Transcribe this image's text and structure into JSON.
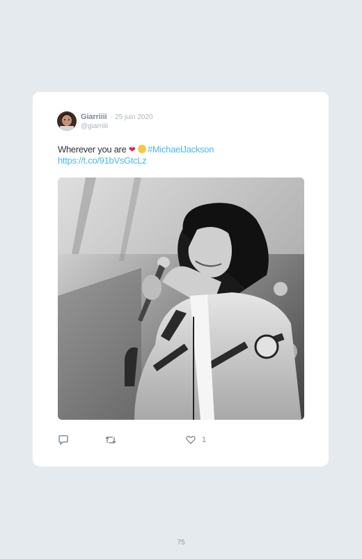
{
  "tweet": {
    "author_name": "Giarriiii",
    "date": "· 25 juin 2020",
    "handle": "@giarriiii",
    "text": "Wherever you are",
    "heart_emoji": "❤",
    "hashtag": "#MichaelJackson",
    "link": "https://t.co/91bVsGtcLz",
    "like_count": "1"
  },
  "icons": {
    "reply": "reply-icon",
    "retweet": "retweet-icon",
    "like": "like-icon"
  },
  "colors": {
    "background": "#e4eaed",
    "card": "#ffffff",
    "link": "#4db6ec",
    "muted": "#a9b4bc"
  },
  "page": {
    "number": "75"
  }
}
